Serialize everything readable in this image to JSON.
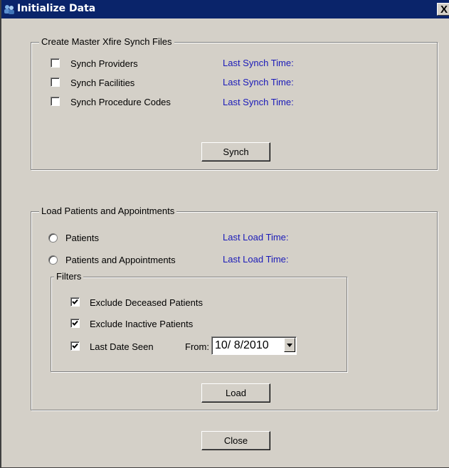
{
  "window": {
    "title": "Initialize Data",
    "close_glyph": "X",
    "icon": "app-users-icon"
  },
  "synch_group": {
    "legend": "Create Master Xfire Synch Files",
    "items": [
      {
        "label": "Synch Providers",
        "checked": false,
        "time_label": "Last Synch Time:"
      },
      {
        "label": "Synch Facilities",
        "checked": false,
        "time_label": "Last Synch Time:"
      },
      {
        "label": "Synch Procedure Codes",
        "checked": false,
        "time_label": "Last Synch Time:"
      }
    ],
    "button_label": "Synch"
  },
  "load_group": {
    "legend": "Load Patients and Appointments",
    "options": [
      {
        "label": "Patients",
        "selected": false,
        "time_label": "Last Load Time:"
      },
      {
        "label": "Patients and Appointments",
        "selected": false,
        "time_label": "Last Load Time:"
      }
    ],
    "filters": {
      "legend": "Filters",
      "items": [
        {
          "label": "Exclude Deceased Patients",
          "checked": true
        },
        {
          "label": "Exclude Inactive Patients",
          "checked": true
        },
        {
          "label": "Last Date Seen",
          "checked": true
        }
      ],
      "from_label": "From:",
      "date_value": "10/ 8/2010"
    },
    "button_label": "Load"
  },
  "close_button_label": "Close",
  "colors": {
    "title_bar": "#0a246a",
    "face": "#d4d0c8",
    "time_label": "#1a1ab8"
  }
}
